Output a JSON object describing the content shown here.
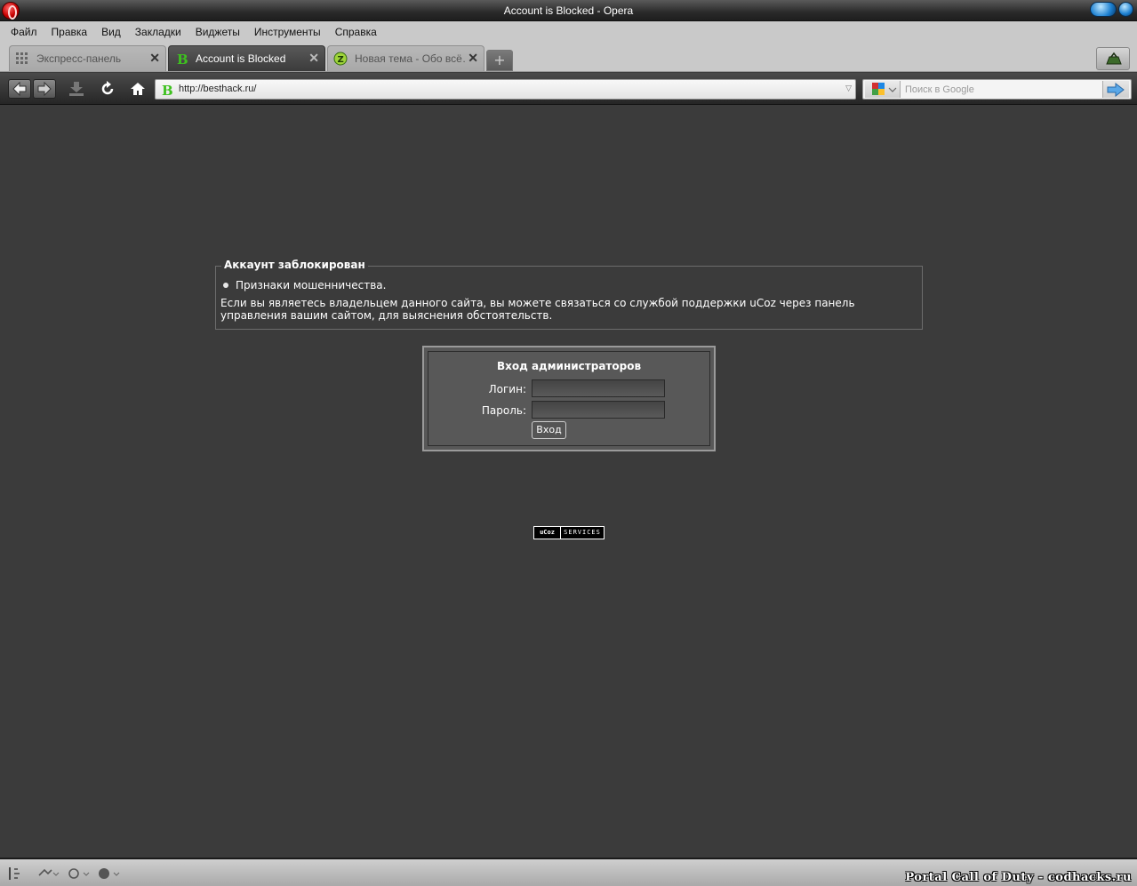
{
  "window": {
    "title": "Account is Blocked - Opera"
  },
  "menu": [
    "Файл",
    "Правка",
    "Вид",
    "Закладки",
    "Виджеты",
    "Инструменты",
    "Справка"
  ],
  "tabs": [
    {
      "label": "Экспресс-панель",
      "icon": "grid-icon",
      "active": false
    },
    {
      "label": "Account is Blocked",
      "icon": "besthack-b-icon",
      "active": true
    },
    {
      "label": "Новая тема - Обо всё…",
      "icon": "forum-icon",
      "active": false
    }
  ],
  "address": {
    "url": "http://besthack.ru/"
  },
  "search": {
    "placeholder": "Поиск в Google",
    "engine": "google-icon"
  },
  "page": {
    "notice": {
      "title": "Аккаунт заблокирован",
      "reason": "Признаки мошенничества.",
      "text": "Если вы являетесь владельцем данного сайта, вы можете связаться со службой поддержки uCoz через панель управления вашим сайтом, для выяснения обстоятельств."
    },
    "login": {
      "title": "Вход администраторов",
      "login_label": "Логин:",
      "password_label": "Пароль:",
      "login_value": "",
      "password_value": "",
      "submit_label": "Вход"
    },
    "badge": {
      "left": "uCoz",
      "right": "SERVICES"
    }
  },
  "status": {
    "watermark": "Portal Call of Duty - codhacks.ru"
  },
  "colors": {
    "page_bg": "#3b3b3b",
    "login_bg": "#585858",
    "accent_green": "#3ec11f"
  }
}
